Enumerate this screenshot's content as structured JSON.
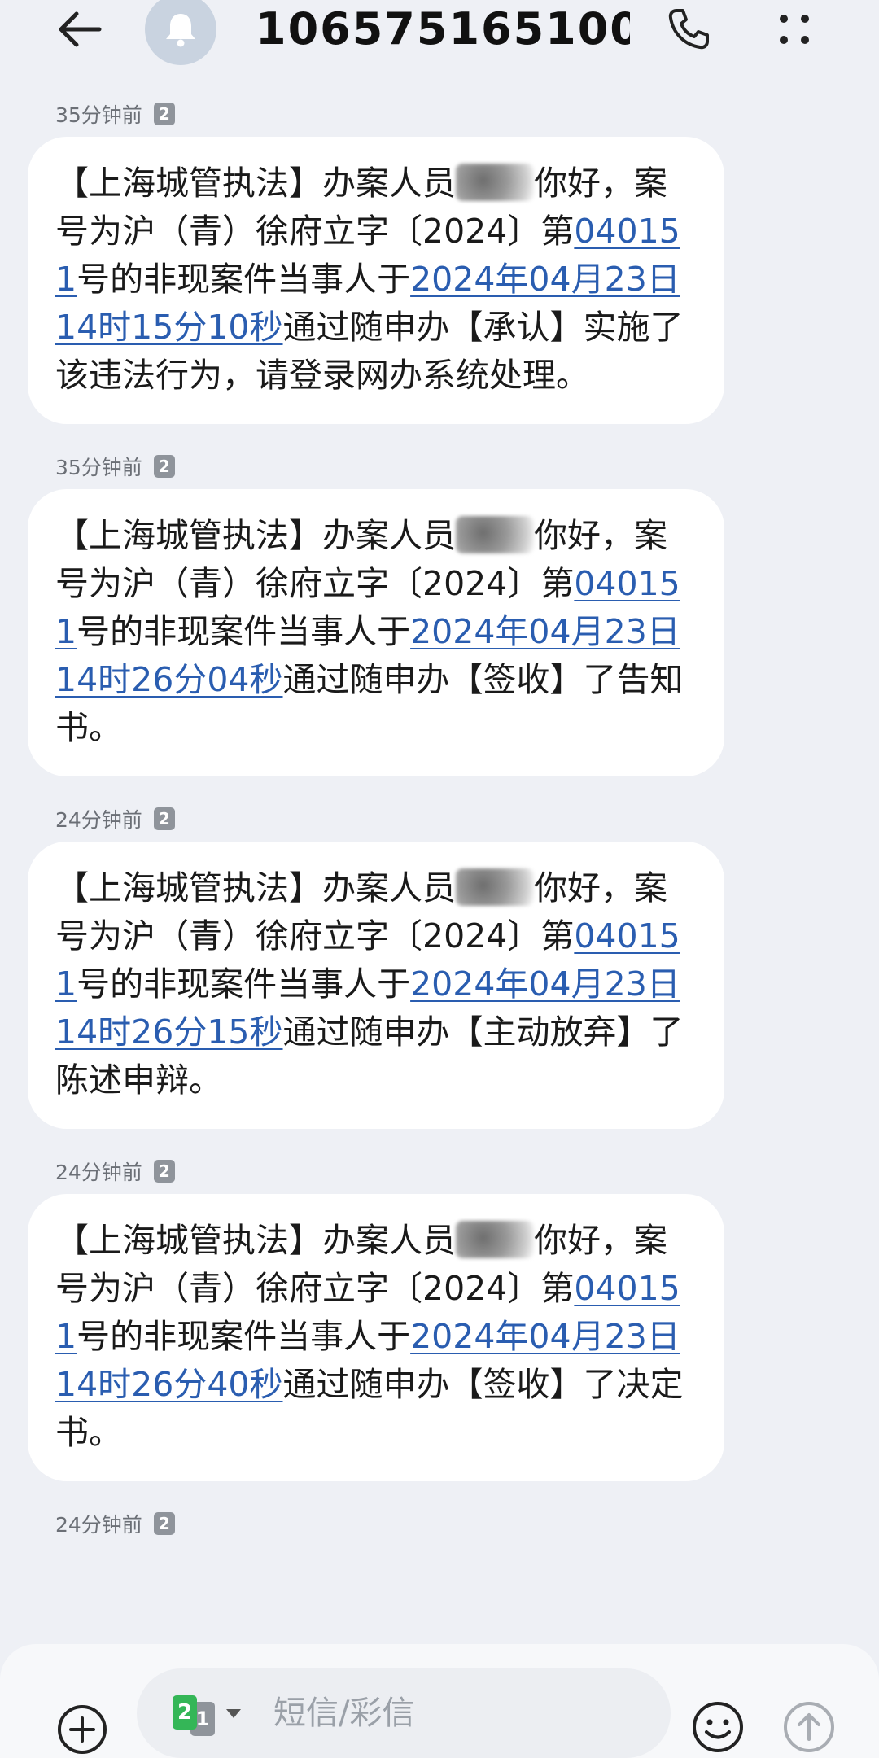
{
  "header": {
    "contact": "106575165100...",
    "back_icon": "arrow-left-icon",
    "avatar_icon": "bell-icon",
    "call_icon": "phone-icon",
    "more_icon": "more-dots-icon"
  },
  "messages": [
    {
      "time": "35分钟前",
      "sim": "2",
      "segments": [
        {
          "t": "text",
          "v": "【上海城管执法】办案人员"
        },
        {
          "t": "redacted"
        },
        {
          "t": "text",
          "v": "你好，案号为沪（青）徐府立字〔2024〕第"
        },
        {
          "t": "link",
          "v": "040151"
        },
        {
          "t": "text",
          "v": "号的非现案件当事人于"
        },
        {
          "t": "link",
          "v": "2024年04月23日 14时15分10秒"
        },
        {
          "t": "text",
          "v": "通过随申办【承认】实施了该违法行为，请登录网办系统处理。"
        }
      ]
    },
    {
      "time": "35分钟前",
      "sim": "2",
      "segments": [
        {
          "t": "text",
          "v": "【上海城管执法】办案人员"
        },
        {
          "t": "redacted"
        },
        {
          "t": "text",
          "v": "你好，案号为沪（青）徐府立字〔2024〕第"
        },
        {
          "t": "link",
          "v": "040151"
        },
        {
          "t": "text",
          "v": "号的非现案件当事人于"
        },
        {
          "t": "link",
          "v": "2024年04月23日 14时26分04秒"
        },
        {
          "t": "text",
          "v": "通过随申办【签收】了告知书。"
        }
      ]
    },
    {
      "time": "24分钟前",
      "sim": "2",
      "segments": [
        {
          "t": "text",
          "v": "【上海城管执法】办案人员"
        },
        {
          "t": "redacted"
        },
        {
          "t": "text",
          "v": "你好，案号为沪（青）徐府立字〔2024〕第"
        },
        {
          "t": "link",
          "v": "040151"
        },
        {
          "t": "text",
          "v": "号的非现案件当事人于"
        },
        {
          "t": "link",
          "v": "2024年04月23日 14时26分15秒"
        },
        {
          "t": "text",
          "v": "通过随申办【主动放弃】了陈述申辩。"
        }
      ]
    },
    {
      "time": "24分钟前",
      "sim": "2",
      "segments": [
        {
          "t": "text",
          "v": "【上海城管执法】办案人员"
        },
        {
          "t": "redacted"
        },
        {
          "t": "text",
          "v": "你好，案号为沪（青）徐府立字〔2024〕第"
        },
        {
          "t": "link",
          "v": "040151"
        },
        {
          "t": "text",
          "v": "号的非现案件当事人于"
        },
        {
          "t": "link",
          "v": "2024年04月23日 14时26分40秒"
        },
        {
          "t": "text",
          "v": "通过随申办【签收】了决定书。"
        }
      ]
    }
  ],
  "trailing_meta": {
    "time": "24分钟前",
    "sim": "2"
  },
  "input_bar": {
    "add_icon": "plus-circle-icon",
    "sim_front": "2",
    "sim_back": "1",
    "placeholder": "短信/彩信",
    "value": "",
    "emoji_icon": "smiley-icon",
    "send_icon": "arrow-up-circle-icon"
  },
  "colors": {
    "background": "#eef0f5",
    "bubble": "#ffffff",
    "link": "#2a5db0",
    "sim_green": "#34b657",
    "meta_gray": "#6b6f76"
  }
}
